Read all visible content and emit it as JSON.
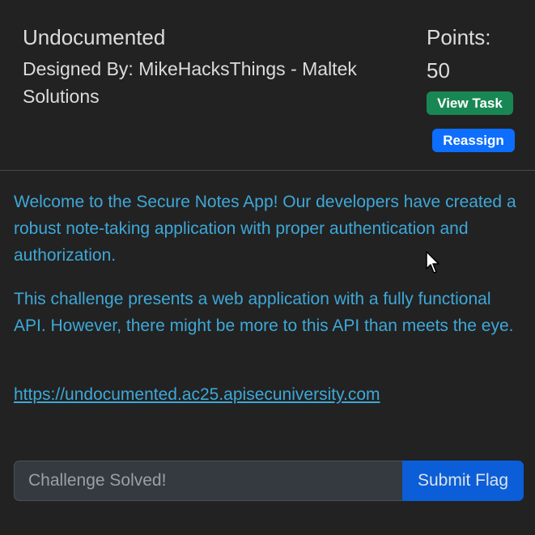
{
  "challenge": {
    "title": "Undocumented",
    "designer": "Designed By: MikeHacksThings - Maltek Solutions",
    "points_label": "Points:",
    "points_value": "50"
  },
  "actions": {
    "view_task_label": "View Task",
    "reassign_label": "Reassign"
  },
  "description": {
    "paragraph_1": "Welcome to the Secure Notes App! Our developers have created a robust note-taking application with proper authentication and authorization.",
    "paragraph_2": "This challenge presents a web application with a fully functional API. However, there might be more to this API than meets the eye.",
    "link_text": "https://undocumented.ac25.apisecuniversity.com"
  },
  "flag_form": {
    "input_value": "",
    "input_placeholder": "Challenge Solved!",
    "submit_label": "Submit Flag"
  },
  "colors": {
    "background": "#222222",
    "text": "#dcdcdc",
    "accent_text": "#3ea8d8",
    "view_task": "#198754",
    "reassign": "#0d6efd",
    "submit": "#0b5ed7"
  },
  "icons": {
    "cursor": "mouse-pointer-icon"
  }
}
